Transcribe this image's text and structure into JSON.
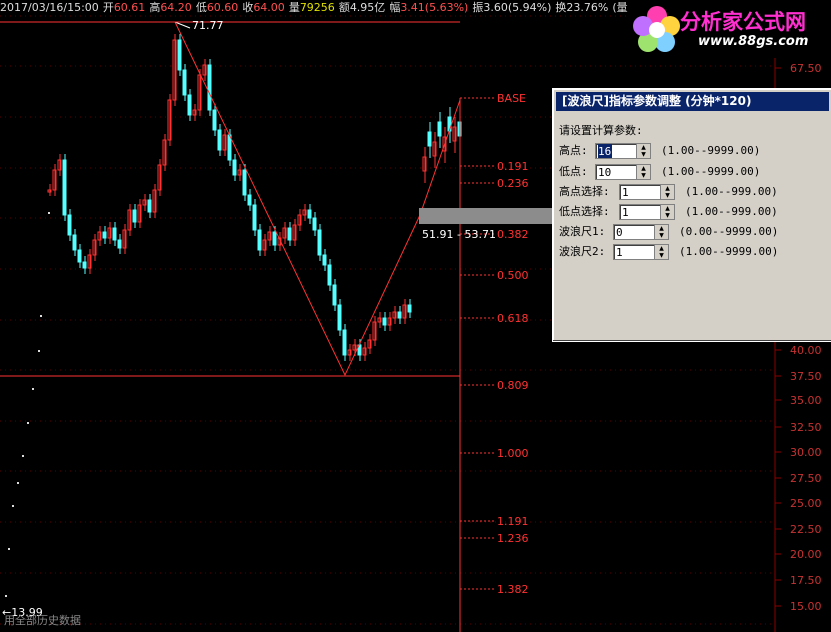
{
  "header": {
    "date": "2017/03/16/15:00",
    "open_label": "开",
    "open": "60.61",
    "high_label": "高",
    "high": "64.20",
    "low_label": "低",
    "low": "60.60",
    "close_label": "收",
    "close": "64.00",
    "vol_label": "量",
    "vol": "79256",
    "amount_label": "额",
    "amount": "4.95亿",
    "change_label": "幅",
    "change": "3.41(5.63%)",
    "amp_label": "振",
    "amp": "3.60(5.94%)",
    "turnover_label": "换",
    "turnover": "23.76%",
    "extra": "(量复"
  },
  "logo": {
    "title": "分析家公式网",
    "url": "www.88gs.com"
  },
  "price_axis": {
    "labels": [
      "67.50",
      "40.00",
      "37.50",
      "35.00",
      "32.50",
      "30.00",
      "27.50",
      "25.00",
      "22.50",
      "20.00",
      "17.50",
      "15.00"
    ]
  },
  "fib_levels": [
    "BASE",
    "0.191",
    "0.236",
    "0.382",
    "0.500",
    "0.618",
    "0.809",
    "1.000",
    "1.191",
    "1.236",
    "1.382"
  ],
  "annotations": {
    "peak": "71.77",
    "range": "51.91 - 53.71",
    "bottom_left": "13.99",
    "bottom_text": "用全部历史数据"
  },
  "dialog": {
    "title": "[波浪尺]指标参数调整 (分钟*120)",
    "prompt": "请设置计算参数:",
    "params": [
      {
        "label": "高点:",
        "value": "16",
        "range": "(1.00--9999.00)"
      },
      {
        "label": "低点:",
        "value": "10",
        "range": "(1.00--9999.00)"
      },
      {
        "label": "高点选择:",
        "value": "1",
        "range": "(1.00--999.00)"
      },
      {
        "label": "低点选择:",
        "value": "1",
        "range": "(1.00--999.00)"
      },
      {
        "label": "波浪尺1:",
        "value": "0",
        "range": "(0.00--9999.00)"
      },
      {
        "label": "波浪尺2:",
        "value": "1",
        "range": "(1.00--9999.00)"
      }
    ]
  },
  "colors": {
    "up": "#ff3232",
    "down": "#54ffff",
    "line": "#ff3232",
    "axis": "#8b0000"
  }
}
